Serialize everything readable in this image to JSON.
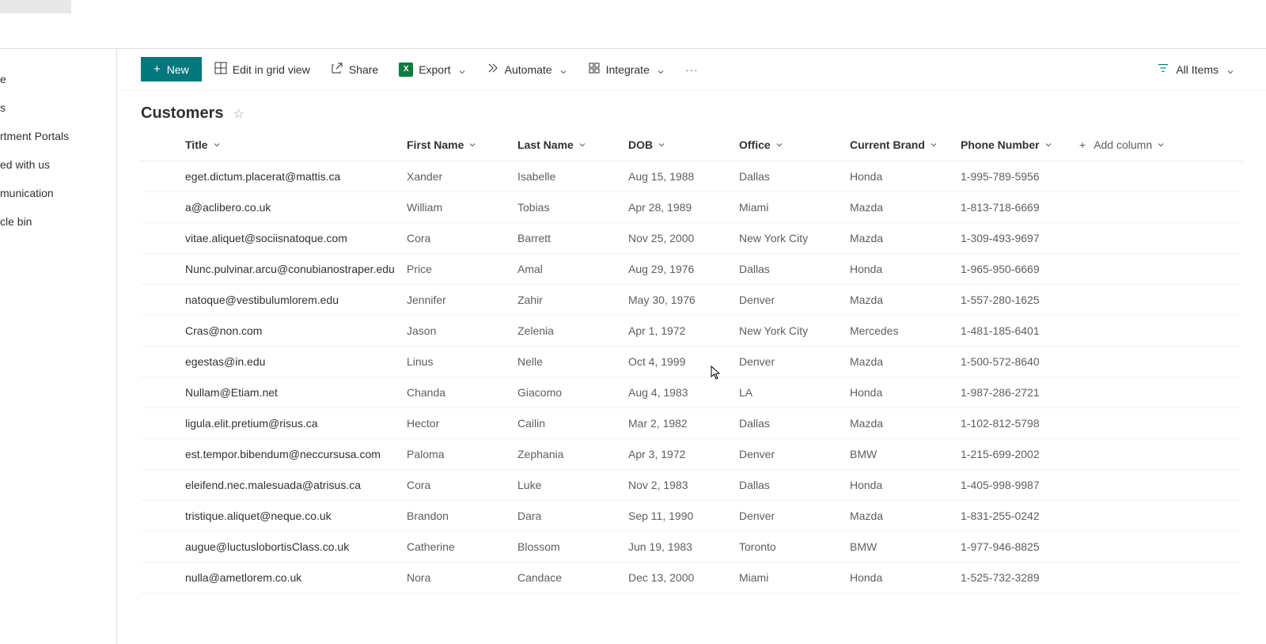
{
  "sidebar": {
    "items": [
      {
        "label": "e"
      },
      {
        "label": "s"
      },
      {
        "label": "rtment Portals"
      },
      {
        "label": "ed with us"
      },
      {
        "label": "munication"
      },
      {
        "label": "cle bin"
      }
    ]
  },
  "toolbar": {
    "new_label": "New",
    "edit_grid_label": "Edit in grid view",
    "share_label": "Share",
    "export_label": "Export",
    "automate_label": "Automate",
    "integrate_label": "Integrate",
    "view_label": "All Items"
  },
  "list": {
    "title": "Customers"
  },
  "columns": [
    {
      "key": "title",
      "label": "Title"
    },
    {
      "key": "first_name",
      "label": "First Name"
    },
    {
      "key": "last_name",
      "label": "Last Name"
    },
    {
      "key": "dob",
      "label": "DOB"
    },
    {
      "key": "office",
      "label": "Office"
    },
    {
      "key": "brand",
      "label": "Current Brand"
    },
    {
      "key": "phone",
      "label": "Phone Number"
    }
  ],
  "add_column_label": "Add column",
  "rows": [
    {
      "title": "eget.dictum.placerat@mattis.ca",
      "first_name": "Xander",
      "last_name": "Isabelle",
      "dob": "Aug 15, 1988",
      "office": "Dallas",
      "brand": "Honda",
      "phone": "1-995-789-5956"
    },
    {
      "title": "a@aclibero.co.uk",
      "first_name": "William",
      "last_name": "Tobias",
      "dob": "Apr 28, 1989",
      "office": "Miami",
      "brand": "Mazda",
      "phone": "1-813-718-6669"
    },
    {
      "title": "vitae.aliquet@sociisnatoque.com",
      "first_name": "Cora",
      "last_name": "Barrett",
      "dob": "Nov 25, 2000",
      "office": "New York City",
      "brand": "Mazda",
      "phone": "1-309-493-9697"
    },
    {
      "title": "Nunc.pulvinar.arcu@conubianostraper.edu",
      "first_name": "Price",
      "last_name": "Amal",
      "dob": "Aug 29, 1976",
      "office": "Dallas",
      "brand": "Honda",
      "phone": "1-965-950-6669"
    },
    {
      "title": "natoque@vestibulumlorem.edu",
      "first_name": "Jennifer",
      "last_name": "Zahir",
      "dob": "May 30, 1976",
      "office": "Denver",
      "brand": "Mazda",
      "phone": "1-557-280-1625"
    },
    {
      "title": "Cras@non.com",
      "first_name": "Jason",
      "last_name": "Zelenia",
      "dob": "Apr 1, 1972",
      "office": "New York City",
      "brand": "Mercedes",
      "phone": "1-481-185-6401"
    },
    {
      "title": "egestas@in.edu",
      "first_name": "Linus",
      "last_name": "Nelle",
      "dob": "Oct 4, 1999",
      "office": "Denver",
      "brand": "Mazda",
      "phone": "1-500-572-8640"
    },
    {
      "title": "Nullam@Etiam.net",
      "first_name": "Chanda",
      "last_name": "Giacomo",
      "dob": "Aug 4, 1983",
      "office": "LA",
      "brand": "Honda",
      "phone": "1-987-286-2721"
    },
    {
      "title": "ligula.elit.pretium@risus.ca",
      "first_name": "Hector",
      "last_name": "Cailin",
      "dob": "Mar 2, 1982",
      "office": "Dallas",
      "brand": "Mazda",
      "phone": "1-102-812-5798"
    },
    {
      "title": "est.tempor.bibendum@neccursusa.com",
      "first_name": "Paloma",
      "last_name": "Zephania",
      "dob": "Apr 3, 1972",
      "office": "Denver",
      "brand": "BMW",
      "phone": "1-215-699-2002"
    },
    {
      "title": "eleifend.nec.malesuada@atrisus.ca",
      "first_name": "Cora",
      "last_name": "Luke",
      "dob": "Nov 2, 1983",
      "office": "Dallas",
      "brand": "Honda",
      "phone": "1-405-998-9987"
    },
    {
      "title": "tristique.aliquet@neque.co.uk",
      "first_name": "Brandon",
      "last_name": "Dara",
      "dob": "Sep 11, 1990",
      "office": "Denver",
      "brand": "Mazda",
      "phone": "1-831-255-0242"
    },
    {
      "title": "augue@luctuslobortisClass.co.uk",
      "first_name": "Catherine",
      "last_name": "Blossom",
      "dob": "Jun 19, 1983",
      "office": "Toronto",
      "brand": "BMW",
      "phone": "1-977-946-8825"
    },
    {
      "title": "nulla@ametlorem.co.uk",
      "first_name": "Nora",
      "last_name": "Candace",
      "dob": "Dec 13, 2000",
      "office": "Miami",
      "brand": "Honda",
      "phone": "1-525-732-3289"
    }
  ]
}
